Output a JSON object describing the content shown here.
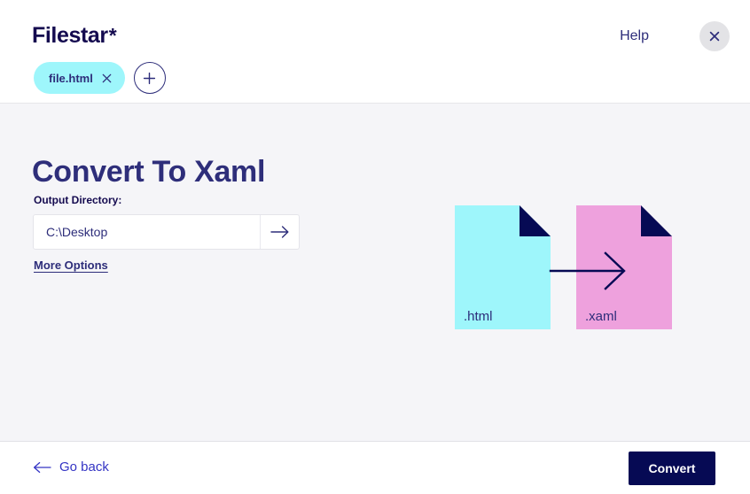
{
  "header": {
    "brand_name": "Filestar",
    "brand_star": "*",
    "help_label": "Help",
    "close_icon": "close-icon"
  },
  "tabs": {
    "open_files": [
      {
        "label": "file.html",
        "close_icon": "close-icon"
      }
    ],
    "add_tab_icon": "plus-icon"
  },
  "main": {
    "title": "Convert To Xaml",
    "output_directory": {
      "label": "Output Directory:",
      "value": "C:\\Desktop",
      "placeholder": "C:\\Desktop",
      "go_icon": "arrow-right-icon"
    },
    "more_options_label": "More Options"
  },
  "illustration": {
    "source_file": {
      "label": ".html",
      "color": "#9ef6fb"
    },
    "target_file": {
      "label": ".xaml",
      "color": "#eea1dd"
    },
    "fold_color": "#060a54",
    "arrow_icon": "arrow-right-icon"
  },
  "footer": {
    "back_label": "Go back",
    "back_icon": "arrow-left-icon",
    "convert_label": "Convert"
  },
  "colors": {
    "navy": "#060a54",
    "indigo": "#2d2d7a",
    "link_blue": "#3434c4",
    "cyan": "#9ef6fb",
    "pink": "#eea1dd",
    "page_bg": "#f5f5f8",
    "surface": "#ffffff"
  }
}
